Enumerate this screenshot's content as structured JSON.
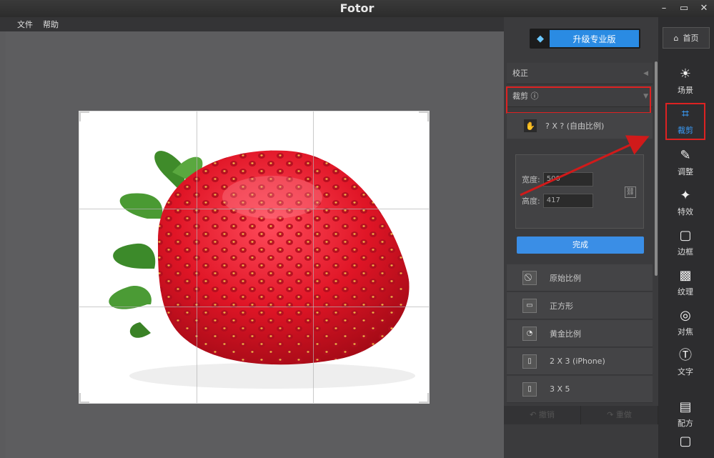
{
  "window": {
    "title": "Fotor",
    "minimize": "–",
    "maximize": "▭",
    "close": "✕"
  },
  "menu": [
    "文件",
    "帮助"
  ],
  "upgrade": {
    "label": "升级专业版",
    "icon": "diamond-icon"
  },
  "panel": {
    "section_correct": "校正",
    "section_crop": "裁剪 ⓘ",
    "free_ratio": "? X ? (自由比例)",
    "width_label": "宽度:",
    "width_value": "500",
    "height_label": "高度:",
    "height_value": "417",
    "done": "完成",
    "presets": [
      {
        "icon": "⃠",
        "label": "原始比例"
      },
      {
        "icon": "▭",
        "label": "正方形"
      },
      {
        "icon": "◔",
        "label": "黄金比例"
      },
      {
        "icon": "▯",
        "label": "2 X 3 (iPhone)"
      },
      {
        "icon": "▯",
        "label": "3 X 5"
      }
    ],
    "undo": "↶ 撤销",
    "redo": "↷ 重做"
  },
  "tools": {
    "home": "首页",
    "items": [
      {
        "glyph": "☀",
        "label": "场景",
        "icon": "scene-icon"
      },
      {
        "glyph": "⌗",
        "label": "裁剪",
        "icon": "crop-icon"
      },
      {
        "glyph": "✎",
        "label": "调整",
        "icon": "adjust-icon"
      },
      {
        "glyph": "✦",
        "label": "特效",
        "icon": "effects-icon"
      },
      {
        "glyph": "▢",
        "label": "边框",
        "icon": "border-icon"
      },
      {
        "glyph": "▩",
        "label": "纹理",
        "icon": "texture-icon"
      },
      {
        "glyph": "◎",
        "label": "对焦",
        "icon": "focus-icon"
      },
      {
        "glyph": "Ⓣ",
        "label": "文字",
        "icon": "text-icon"
      },
      {
        "glyph": "▤",
        "label": "配方",
        "icon": "recipe-icon"
      },
      {
        "glyph": "▢",
        "label": "",
        "icon": "more-icon"
      }
    ]
  },
  "colors": {
    "accent": "#2a8be3",
    "highlight": "#dd2222"
  }
}
